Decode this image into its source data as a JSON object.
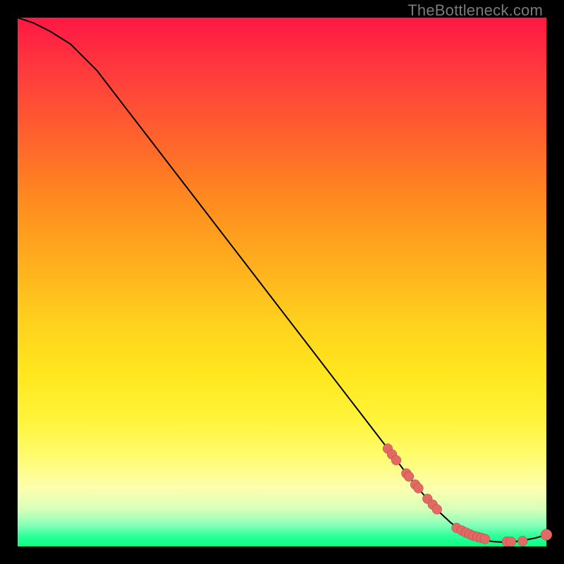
{
  "watermark": "TheBottleneck.com",
  "chart_data": {
    "type": "line",
    "title": "",
    "xlabel": "",
    "ylabel": "",
    "xlim": [
      0,
      100
    ],
    "ylim": [
      0,
      100
    ],
    "grid": false,
    "legend": false,
    "annotations": [],
    "series": [
      {
        "name": "curve",
        "x": [
          0,
          3,
          6,
          10,
          15,
          20,
          25,
          30,
          35,
          40,
          45,
          50,
          55,
          60,
          65,
          70,
          73,
          76,
          79,
          82,
          84,
          86,
          88,
          90,
          92,
          94,
          96,
          98,
          100
        ],
        "y": [
          100,
          99,
          97.5,
          95,
          90,
          83.5,
          77,
          70.5,
          64,
          57.5,
          51,
          44.5,
          38,
          31.5,
          25,
          18.5,
          14.5,
          10.7,
          7.2,
          4.4,
          3.0,
          2.0,
          1.3,
          0.9,
          0.8,
          0.9,
          1.2,
          1.6,
          2.2
        ]
      }
    ],
    "markers": {
      "name": "points",
      "x": [
        70.0,
        70.8,
        71.6,
        73.5,
        74.0,
        75.2,
        75.8,
        77.5,
        78.5,
        79.3,
        83.0,
        84.0,
        84.8,
        85.5,
        86.2,
        87.0,
        87.7,
        88.4,
        92.5,
        93.3,
        95.5,
        100.0
      ],
      "y": [
        18.5,
        17.4,
        16.3,
        13.8,
        13.2,
        11.7,
        11.0,
        9.0,
        7.9,
        7.0,
        3.5,
        3.0,
        2.6,
        2.3,
        2.0,
        1.8,
        1.6,
        1.4,
        0.9,
        0.9,
        1.0,
        2.2
      ]
    }
  }
}
